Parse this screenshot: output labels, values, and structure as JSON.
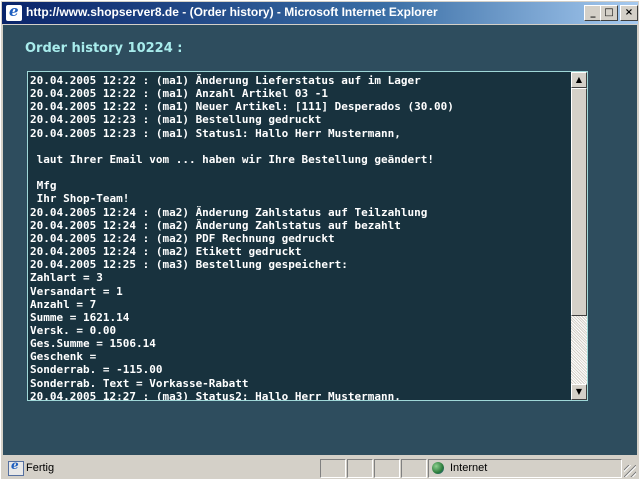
{
  "window": {
    "title": "http://www.shopserver8.de - (Order history) - Microsoft Internet Explorer",
    "controls": {
      "minimize": "_",
      "maximize": "□",
      "close": "×"
    }
  },
  "page": {
    "heading": "Order history 10224 :",
    "log_lines": [
      "20.04.2005 12:22 : (ma1) Änderung Lieferstatus auf im Lager",
      "20.04.2005 12:22 : (ma1) Anzahl Artikel 03 -1",
      "20.04.2005 12:22 : (ma1) Neuer Artikel: [111] Desperados (30.00)",
      "20.04.2005 12:23 : (ma1) Bestellung gedruckt",
      "20.04.2005 12:23 : (ma1) Status1: Hallo Herr Mustermann,",
      "",
      " laut Ihrer Email vom ... haben wir Ihre Bestellung geändert!",
      "",
      " Mfg",
      " Ihr Shop-Team!",
      "20.04.2005 12:24 : (ma2) Änderung Zahlstatus auf Teilzahlung",
      "20.04.2005 12:24 : (ma2) Änderung Zahlstatus auf bezahlt",
      "20.04.2005 12:24 : (ma2) PDF Rechnung gedruckt",
      "20.04.2005 12:24 : (ma2) Etikett gedruckt",
      "20.04.2005 12:25 : (ma3) Bestellung gespeichert:",
      "Zahlart = 3",
      "Versandart = 1",
      "Anzahl = 7",
      "Summe = 1621.14",
      "Versk. = 0.00",
      "Ges.Summe = 1506.14",
      "Geschenk =",
      "Sonderrab. = -115.00",
      "Sonderrab. Text = Vorkasse-Rabatt",
      "20.04.2005 12:27 : (ma3) Status2: Hallo Herr Mustermann,"
    ],
    "scroll": {
      "up_arrow": "▲",
      "down_arrow": "▼"
    }
  },
  "statusbar": {
    "status": "Fertig",
    "zone": "Internet"
  },
  "icons": {
    "app": "ie-icon",
    "status": "page-icon",
    "zone": "globe-icon"
  }
}
